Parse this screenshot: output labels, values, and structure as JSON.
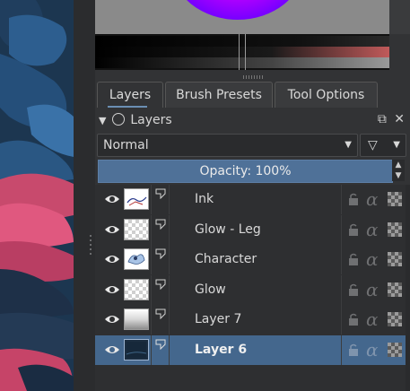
{
  "tabs": [
    {
      "label": "Layers",
      "active": true
    },
    {
      "label": "Brush Presets",
      "active": false
    },
    {
      "label": "Tool Options",
      "active": false
    }
  ],
  "panel": {
    "title": "Layers"
  },
  "blend_mode": {
    "value": "Normal"
  },
  "opacity": {
    "text": "Opacity:  100%"
  },
  "layers": [
    {
      "name": "Ink",
      "selected": false,
      "thumb": "ink-thumbnail"
    },
    {
      "name": "Glow - Leg",
      "selected": false,
      "thumb": "transparent-thumbnail"
    },
    {
      "name": "Character",
      "selected": false,
      "thumb": "character-thumbnail"
    },
    {
      "name": "Glow",
      "selected": false,
      "thumb": "transparent-thumbnail"
    },
    {
      "name": "Layer 7",
      "selected": false,
      "thumb": "gradient-thumbnail"
    },
    {
      "name": "Layer 6",
      "selected": true,
      "thumb": "dark-thumbnail"
    }
  ],
  "colors": {
    "selection": "#44678d",
    "opacity_bar": "#4f7198",
    "panel": "#323335"
  }
}
